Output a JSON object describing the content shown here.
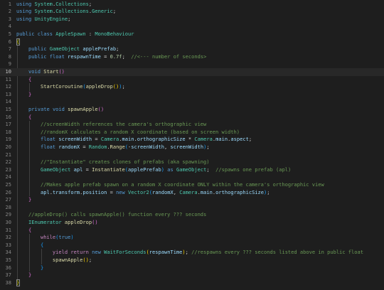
{
  "editor": {
    "language": "C#",
    "active_line": 10,
    "colors": {
      "background": "#1e1e1e",
      "keyword": "#569cd6",
      "control_keyword": "#c586c0",
      "type": "#4ec9b0",
      "function": "#dcdcaa",
      "variable": "#9cdcfe",
      "number": "#b5cea8",
      "comment": "#6a9955",
      "default_text": "#d4d4d4",
      "line_number": "#858585",
      "bracket_level_1": "#ffd700",
      "bracket_level_2": "#da70d6",
      "bracket_level_3": "#179fff"
    },
    "lines": [
      {
        "n": "1",
        "tokens": [
          [
            "kw",
            "using"
          ],
          [
            "t",
            " "
          ],
          [
            "type",
            "System"
          ],
          [
            "t",
            "."
          ],
          [
            "type",
            "Collections"
          ],
          [
            "t",
            ";"
          ]
        ]
      },
      {
        "n": "2",
        "tokens": [
          [
            "kw",
            "using"
          ],
          [
            "t",
            " "
          ],
          [
            "type",
            "System"
          ],
          [
            "t",
            "."
          ],
          [
            "type",
            "Collections"
          ],
          [
            "t",
            "."
          ],
          [
            "type",
            "Generic"
          ],
          [
            "t",
            ";"
          ]
        ]
      },
      {
        "n": "3",
        "tokens": [
          [
            "kw",
            "using"
          ],
          [
            "t",
            " "
          ],
          [
            "type",
            "UnityEngine"
          ],
          [
            "t",
            ";"
          ]
        ]
      },
      {
        "n": "4",
        "tokens": []
      },
      {
        "n": "5",
        "tokens": [
          [
            "kw",
            "public"
          ],
          [
            "t",
            " "
          ],
          [
            "kw",
            "class"
          ],
          [
            "t",
            " "
          ],
          [
            "type",
            "AppleSpawn"
          ],
          [
            "t",
            " : "
          ],
          [
            "type",
            "MonoBehaviour"
          ]
        ]
      },
      {
        "n": "6",
        "tokens": [
          [
            "p1",
            "{"
          ]
        ]
      },
      {
        "n": "7",
        "tokens": [
          [
            "t",
            "    "
          ],
          [
            "kw",
            "public"
          ],
          [
            "t",
            " "
          ],
          [
            "type",
            "GameObject"
          ],
          [
            "t",
            " "
          ],
          [
            "var",
            "applePrefab"
          ],
          [
            "t",
            ";"
          ]
        ]
      },
      {
        "n": "8",
        "tokens": [
          [
            "t",
            "    "
          ],
          [
            "kw",
            "public"
          ],
          [
            "t",
            " "
          ],
          [
            "kw",
            "float"
          ],
          [
            "t",
            " "
          ],
          [
            "var",
            "respawnTime"
          ],
          [
            "t",
            " = "
          ],
          [
            "num",
            "0.7f"
          ],
          [
            "t",
            ";  "
          ],
          [
            "com",
            "//<--- number of seconds>"
          ]
        ]
      },
      {
        "n": "9",
        "tokens": []
      },
      {
        "n": "10",
        "tokens": [
          [
            "t",
            "    "
          ],
          [
            "kw",
            "void"
          ],
          [
            "t",
            " "
          ],
          [
            "fn",
            "Start"
          ],
          [
            "p2",
            "()"
          ]
        ]
      },
      {
        "n": "11",
        "tokens": [
          [
            "t",
            "    "
          ],
          [
            "p2",
            "{"
          ]
        ]
      },
      {
        "n": "12",
        "tokens": [
          [
            "t",
            "        "
          ],
          [
            "fn",
            "StartCoroutine"
          ],
          [
            "p3",
            "("
          ],
          [
            "fn",
            "appleDrop"
          ],
          [
            "p1",
            "()"
          ],
          [
            "p3",
            ")"
          ],
          [
            "t",
            ";"
          ]
        ]
      },
      {
        "n": "13",
        "tokens": [
          [
            "t",
            "    "
          ],
          [
            "p2",
            "}"
          ]
        ]
      },
      {
        "n": "14",
        "tokens": []
      },
      {
        "n": "15",
        "tokens": [
          [
            "t",
            "    "
          ],
          [
            "kw",
            "private"
          ],
          [
            "t",
            " "
          ],
          [
            "kw",
            "void"
          ],
          [
            "t",
            " "
          ],
          [
            "fn",
            "spawnApple"
          ],
          [
            "p2",
            "()"
          ]
        ]
      },
      {
        "n": "16",
        "tokens": [
          [
            "t",
            "    "
          ],
          [
            "p2",
            "{"
          ]
        ]
      },
      {
        "n": "17",
        "tokens": [
          [
            "t",
            "        "
          ],
          [
            "com",
            "//screenWidth references the camera's orthographic view"
          ]
        ]
      },
      {
        "n": "18",
        "tokens": [
          [
            "t",
            "        "
          ],
          [
            "com",
            "//randomX calculates a random X coordinate (based on screen width)"
          ]
        ]
      },
      {
        "n": "19",
        "tokens": [
          [
            "t",
            "        "
          ],
          [
            "kw",
            "float"
          ],
          [
            "t",
            " "
          ],
          [
            "var",
            "screenWidth"
          ],
          [
            "t",
            " = "
          ],
          [
            "type",
            "Camera"
          ],
          [
            "t",
            "."
          ],
          [
            "var",
            "main"
          ],
          [
            "t",
            "."
          ],
          [
            "var",
            "orthographicSize"
          ],
          [
            "t",
            " * "
          ],
          [
            "type",
            "Camera"
          ],
          [
            "t",
            "."
          ],
          [
            "var",
            "main"
          ],
          [
            "t",
            "."
          ],
          [
            "var",
            "aspect"
          ],
          [
            "t",
            ";"
          ]
        ]
      },
      {
        "n": "20",
        "tokens": [
          [
            "t",
            "        "
          ],
          [
            "kw",
            "float"
          ],
          [
            "t",
            " "
          ],
          [
            "var",
            "randomX"
          ],
          [
            "t",
            " = "
          ],
          [
            "type",
            "Random"
          ],
          [
            "t",
            "."
          ],
          [
            "fn",
            "Range"
          ],
          [
            "p3",
            "("
          ],
          [
            "t",
            "-"
          ],
          [
            "var",
            "screenWidth"
          ],
          [
            "t",
            ", "
          ],
          [
            "var",
            "screenWidth"
          ],
          [
            "p3",
            ")"
          ],
          [
            "t",
            ";"
          ]
        ]
      },
      {
        "n": "21",
        "tokens": []
      },
      {
        "n": "22",
        "tokens": [
          [
            "t",
            "        "
          ],
          [
            "com",
            "//\"Instantiate\" creates clones of prefabs (aka spawning)"
          ]
        ]
      },
      {
        "n": "23",
        "tokens": [
          [
            "t",
            "        "
          ],
          [
            "type",
            "GameObject"
          ],
          [
            "t",
            " "
          ],
          [
            "var",
            "apl"
          ],
          [
            "t",
            " = "
          ],
          [
            "fn",
            "Instantiate"
          ],
          [
            "p3",
            "("
          ],
          [
            "var",
            "applePrefab"
          ],
          [
            "p3",
            ")"
          ],
          [
            "t",
            " "
          ],
          [
            "kw",
            "as"
          ],
          [
            "t",
            " "
          ],
          [
            "type",
            "GameObject"
          ],
          [
            "t",
            ";  "
          ],
          [
            "com",
            "//spawns one prefab (apl)"
          ]
        ]
      },
      {
        "n": "24",
        "tokens": []
      },
      {
        "n": "25",
        "tokens": [
          [
            "t",
            "        "
          ],
          [
            "com",
            "//Makes apple prefab spawn on a random X coordinate ONLY within the camera's orthographic view"
          ]
        ]
      },
      {
        "n": "26",
        "tokens": [
          [
            "t",
            "        "
          ],
          [
            "var",
            "apl"
          ],
          [
            "t",
            "."
          ],
          [
            "var",
            "transform"
          ],
          [
            "t",
            "."
          ],
          [
            "var",
            "position"
          ],
          [
            "t",
            " = "
          ],
          [
            "kw",
            "new"
          ],
          [
            "t",
            " "
          ],
          [
            "type",
            "Vector2"
          ],
          [
            "p3",
            "("
          ],
          [
            "var",
            "randomX"
          ],
          [
            "t",
            ", "
          ],
          [
            "type",
            "Camera"
          ],
          [
            "t",
            "."
          ],
          [
            "var",
            "main"
          ],
          [
            "t",
            "."
          ],
          [
            "var",
            "orthographicSize"
          ],
          [
            "p3",
            ")"
          ],
          [
            "t",
            ";"
          ]
        ]
      },
      {
        "n": "27",
        "tokens": [
          [
            "t",
            "    "
          ],
          [
            "p2",
            "}"
          ]
        ]
      },
      {
        "n": "28",
        "tokens": []
      },
      {
        "n": "29",
        "tokens": [
          [
            "t",
            "    "
          ],
          [
            "com",
            "//appleDrop() calls spawnApple() function every ??? seconds"
          ]
        ]
      },
      {
        "n": "30",
        "tokens": [
          [
            "t",
            "    "
          ],
          [
            "type",
            "IEnumerator"
          ],
          [
            "t",
            " "
          ],
          [
            "fn",
            "appleDrop"
          ],
          [
            "p2",
            "()"
          ]
        ]
      },
      {
        "n": "31",
        "tokens": [
          [
            "t",
            "    "
          ],
          [
            "p2",
            "{"
          ]
        ]
      },
      {
        "n": "32",
        "tokens": [
          [
            "t",
            "        "
          ],
          [
            "ctl",
            "while"
          ],
          [
            "p3",
            "("
          ],
          [
            "kw",
            "true"
          ],
          [
            "p3",
            ")"
          ]
        ]
      },
      {
        "n": "33",
        "tokens": [
          [
            "t",
            "        "
          ],
          [
            "p3",
            "{"
          ]
        ]
      },
      {
        "n": "34",
        "tokens": [
          [
            "t",
            "            "
          ],
          [
            "ctl",
            "yield"
          ],
          [
            "t",
            " "
          ],
          [
            "ctl",
            "return"
          ],
          [
            "t",
            " "
          ],
          [
            "kw",
            "new"
          ],
          [
            "t",
            " "
          ],
          [
            "type",
            "WaitForSeconds"
          ],
          [
            "p1",
            "("
          ],
          [
            "var",
            "respawnTime"
          ],
          [
            "p1",
            ")"
          ],
          [
            "t",
            "; "
          ],
          [
            "com",
            "//respawns every ??? seconds listed above in public float"
          ]
        ]
      },
      {
        "n": "35",
        "tokens": [
          [
            "t",
            "            "
          ],
          [
            "fn",
            "spawnApple"
          ],
          [
            "p1",
            "()"
          ],
          [
            "t",
            ";"
          ]
        ]
      },
      {
        "n": "36",
        "tokens": [
          [
            "t",
            "        "
          ],
          [
            "p3",
            "}"
          ]
        ]
      },
      {
        "n": "37",
        "tokens": [
          [
            "t",
            "    "
          ],
          [
            "p2",
            "}"
          ]
        ]
      },
      {
        "n": "38",
        "tokens": [
          [
            "p1",
            "}"
          ]
        ]
      }
    ]
  }
}
